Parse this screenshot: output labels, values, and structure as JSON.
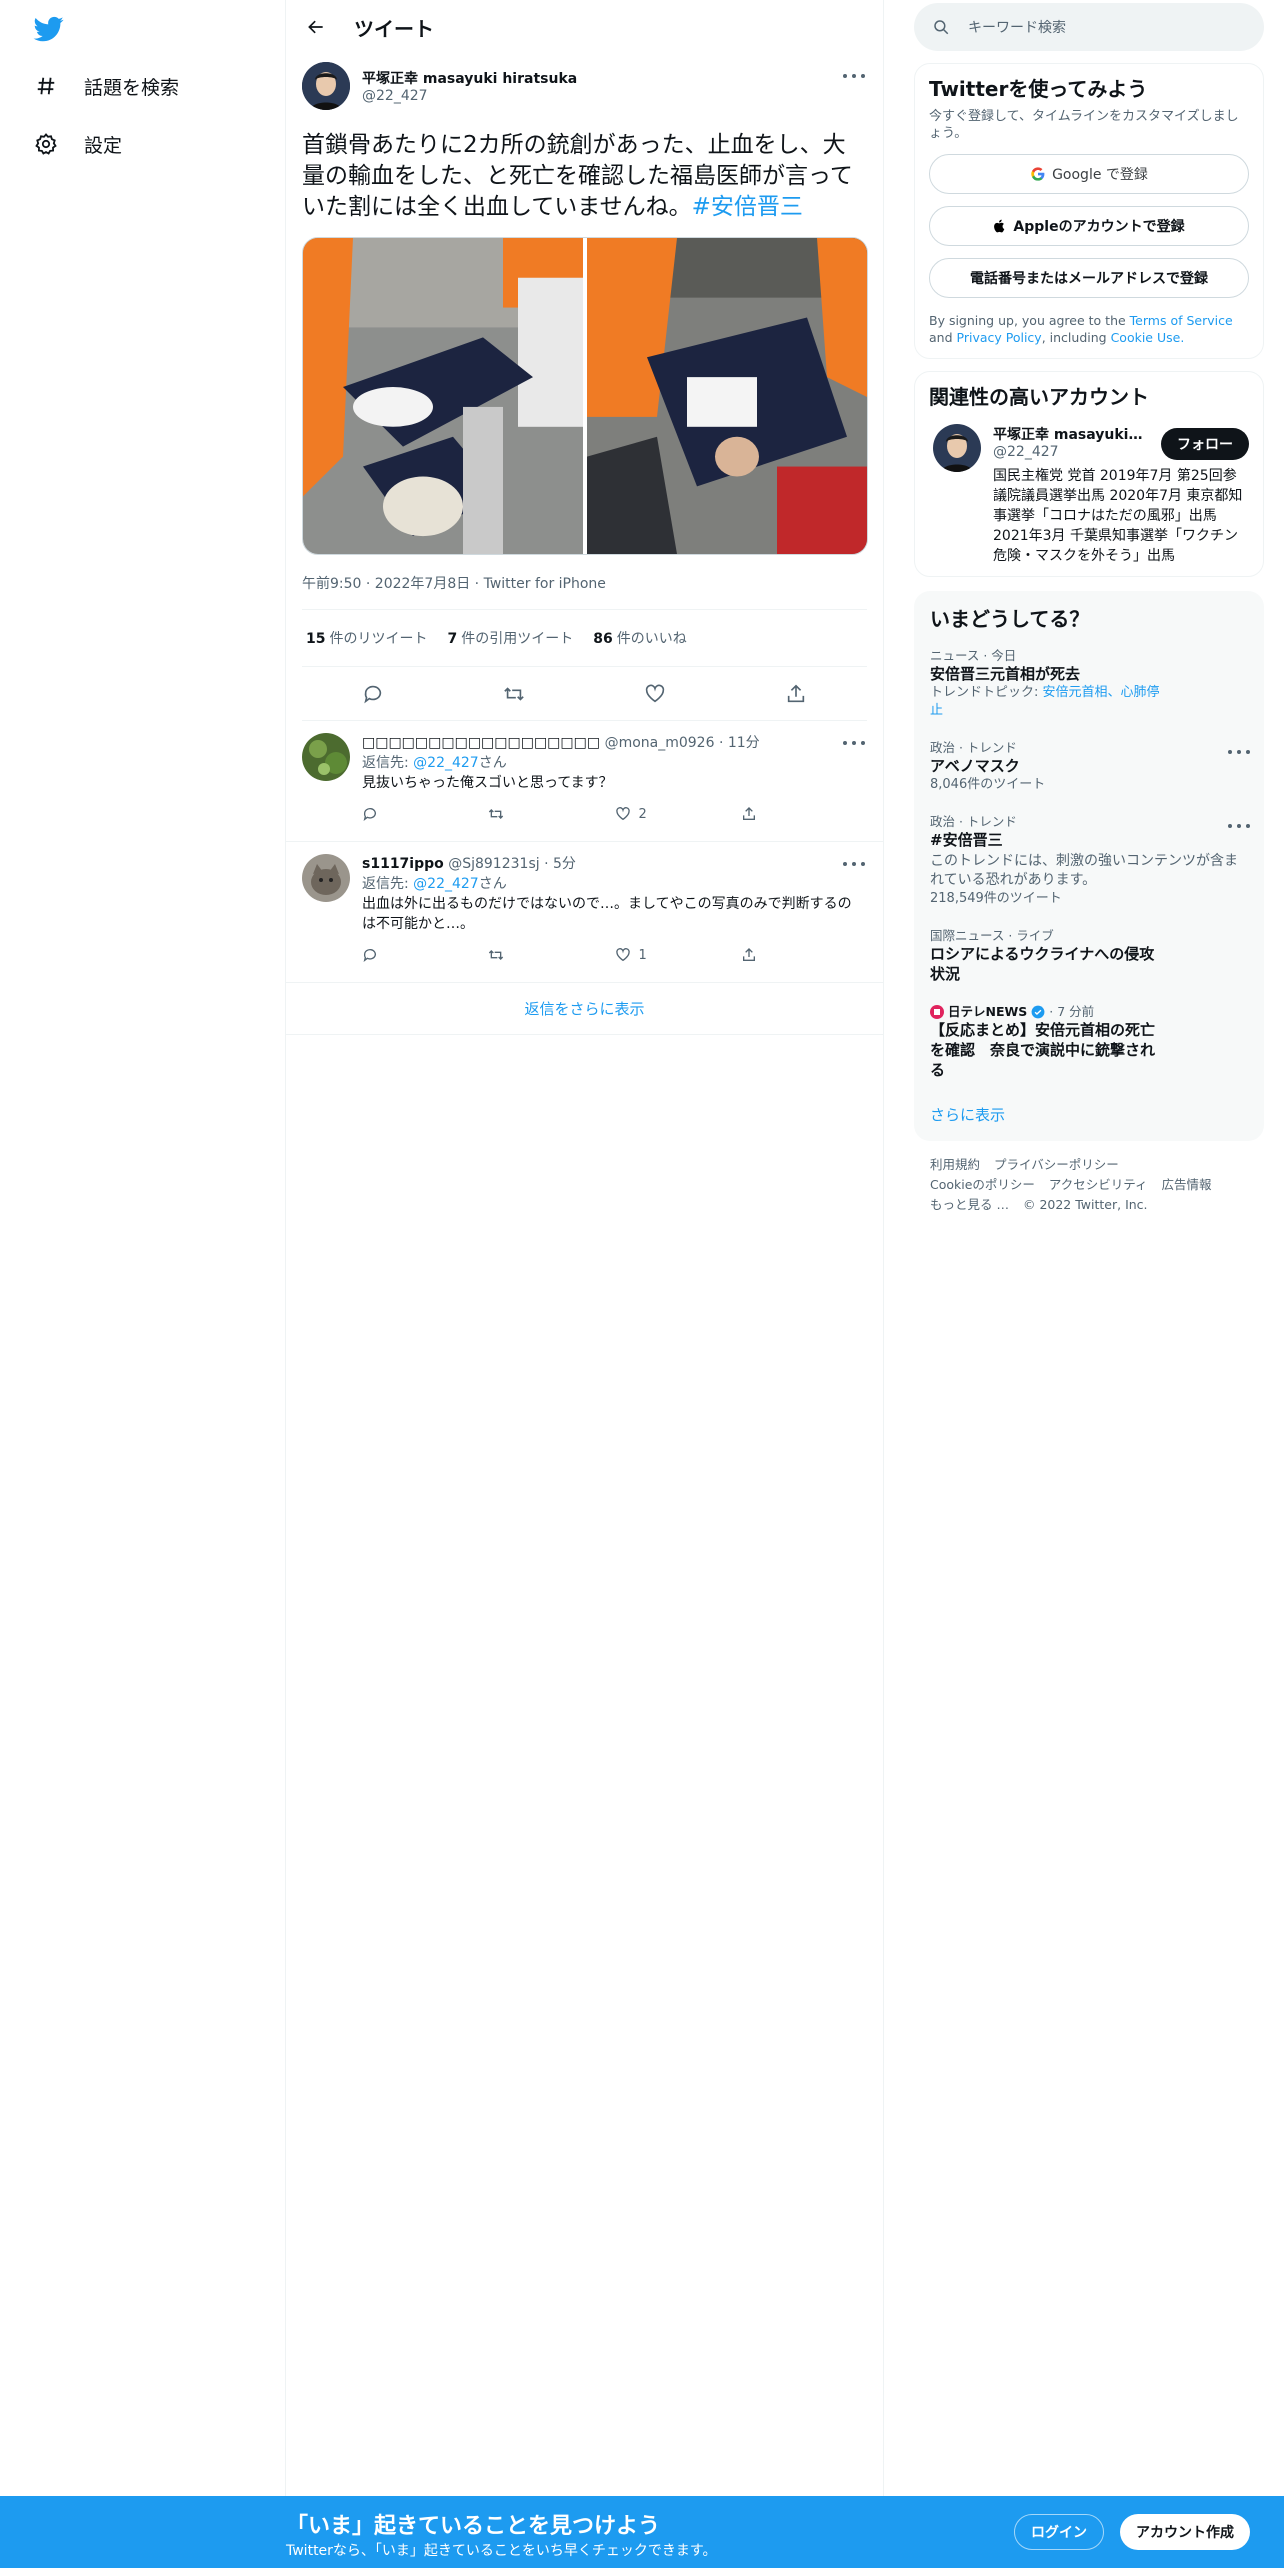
{
  "nav": {
    "items": [
      {
        "label": "話題を検索",
        "icon": "hashtag-icon"
      },
      {
        "label": "設定",
        "icon": "gear-icon"
      }
    ]
  },
  "header": {
    "title": "ツイート"
  },
  "tweet": {
    "author_name": "平塚正幸 masayuki hiratsuka",
    "author_handle": "@22_427",
    "text": "首鎖骨あたりに2カ所の銃創があった、止血をし、大量の輸血をした、と死亡を確認した福島医師が言っていた割には全く出血していませんね。",
    "hashtag": "#安倍晋三",
    "timestamp": "午前9:50 · 2022年7月8日",
    "source": "Twitter for iPhone",
    "retweets_count": "15",
    "retweets_label": "件のリツイート",
    "quotes_count": "7",
    "quotes_label": "件の引用ツイート",
    "likes_count": "86",
    "likes_label": "件のいいね"
  },
  "replies": [
    {
      "name": "□□□□□□□□□□□□□□□□□□",
      "handle": "@mona_m0926",
      "time": "11分",
      "reply_to_label": "返信先:",
      "reply_to_handle": "@22_427",
      "reply_to_suffix": "さん",
      "body": "見抜いちゃった俺スゴいと思ってます？",
      "likes": "2"
    },
    {
      "name": "s1117ippo",
      "handle": "@Sj891231sj",
      "time": "5分",
      "reply_to_label": "返信先:",
      "reply_to_handle": "@22_427",
      "reply_to_suffix": "さん",
      "body": "出血は外に出るものだけではないので…。ましてやこの写真のみで判断するのは不可能かと…。",
      "likes": "1"
    }
  ],
  "show_more_replies": "返信をさらに表示",
  "search": {
    "placeholder": "キーワード検索"
  },
  "signup": {
    "title": "Twitterを使ってみよう",
    "subtitle": "今すぐ登録して、タイムラインをカスタマイズしましょう。",
    "google": "Google で登録",
    "apple": "Appleのアカウントで登録",
    "phone": "電話番号またはメールアドレスで登録",
    "terms_pre": "By signing up, you agree to the",
    "terms_tos": "Terms of Service",
    "terms_and": "and",
    "terms_privacy": "Privacy Policy",
    "terms_including": ", including",
    "terms_cookie": "Cookie Use."
  },
  "related": {
    "title": "関連性の高いアカウント",
    "name": "平塚正幸 masayuki hiratsuka",
    "handle": "@22_427",
    "follow": "フォロー",
    "bio": "国民主権党 党首 2019年7月 第25回参議院議員選挙出馬 2020年7月 東京都知事選挙「コロナはただの風邪」出馬 2021年3月 千葉県知事選挙「ワクチン危険・マスクを外そう」出馬"
  },
  "trends": {
    "title": "いまどうしてる？",
    "items": [
      {
        "context": "ニュース · 今日",
        "title": "安倍晋三元首相が死去",
        "extra_label": "トレンドトピック:",
        "extra_links": "安倍元首相、心肺停止"
      },
      {
        "context": "政治 · トレンド",
        "title": "アベノマスク",
        "count": "8,046件のツイート"
      },
      {
        "context": "政治 · トレンド",
        "title": "#安倍晋三",
        "warning": "このトレンドには、刺激の強いコンテンツが含まれている恐れがあります。",
        "count": "218,549件のツイート"
      },
      {
        "context": "国際ニュース · ライブ",
        "title": "ロシアによるウクライナへの侵攻状況"
      },
      {
        "source": "日テレNEWS",
        "time": "· 7 分前",
        "title": "【反応まとめ】安倍元首相の死亡を確認　奈良で演説中に銃撃される"
      }
    ],
    "show_more": "さらに表示"
  },
  "footer": {
    "links_row1": [
      "利用規約",
      "プライバシーポリシー"
    ],
    "links_row2": [
      "Cookieのポリシー",
      "アクセシビリティ",
      "広告情報"
    ],
    "more": "もっと見る …",
    "copyright": "© 2022 Twitter, Inc."
  },
  "bottom_bar": {
    "title": "「いま」起きていることを見つけよう",
    "subtitle": "Twitterなら、「いま」起きていることをいち早くチェックできます。",
    "login": "ログイン",
    "signup": "アカウント作成"
  },
  "colors": {
    "accent": "#1d9bf0",
    "text": "#0f1419",
    "muted": "#536471",
    "border": "#eff3f4"
  }
}
